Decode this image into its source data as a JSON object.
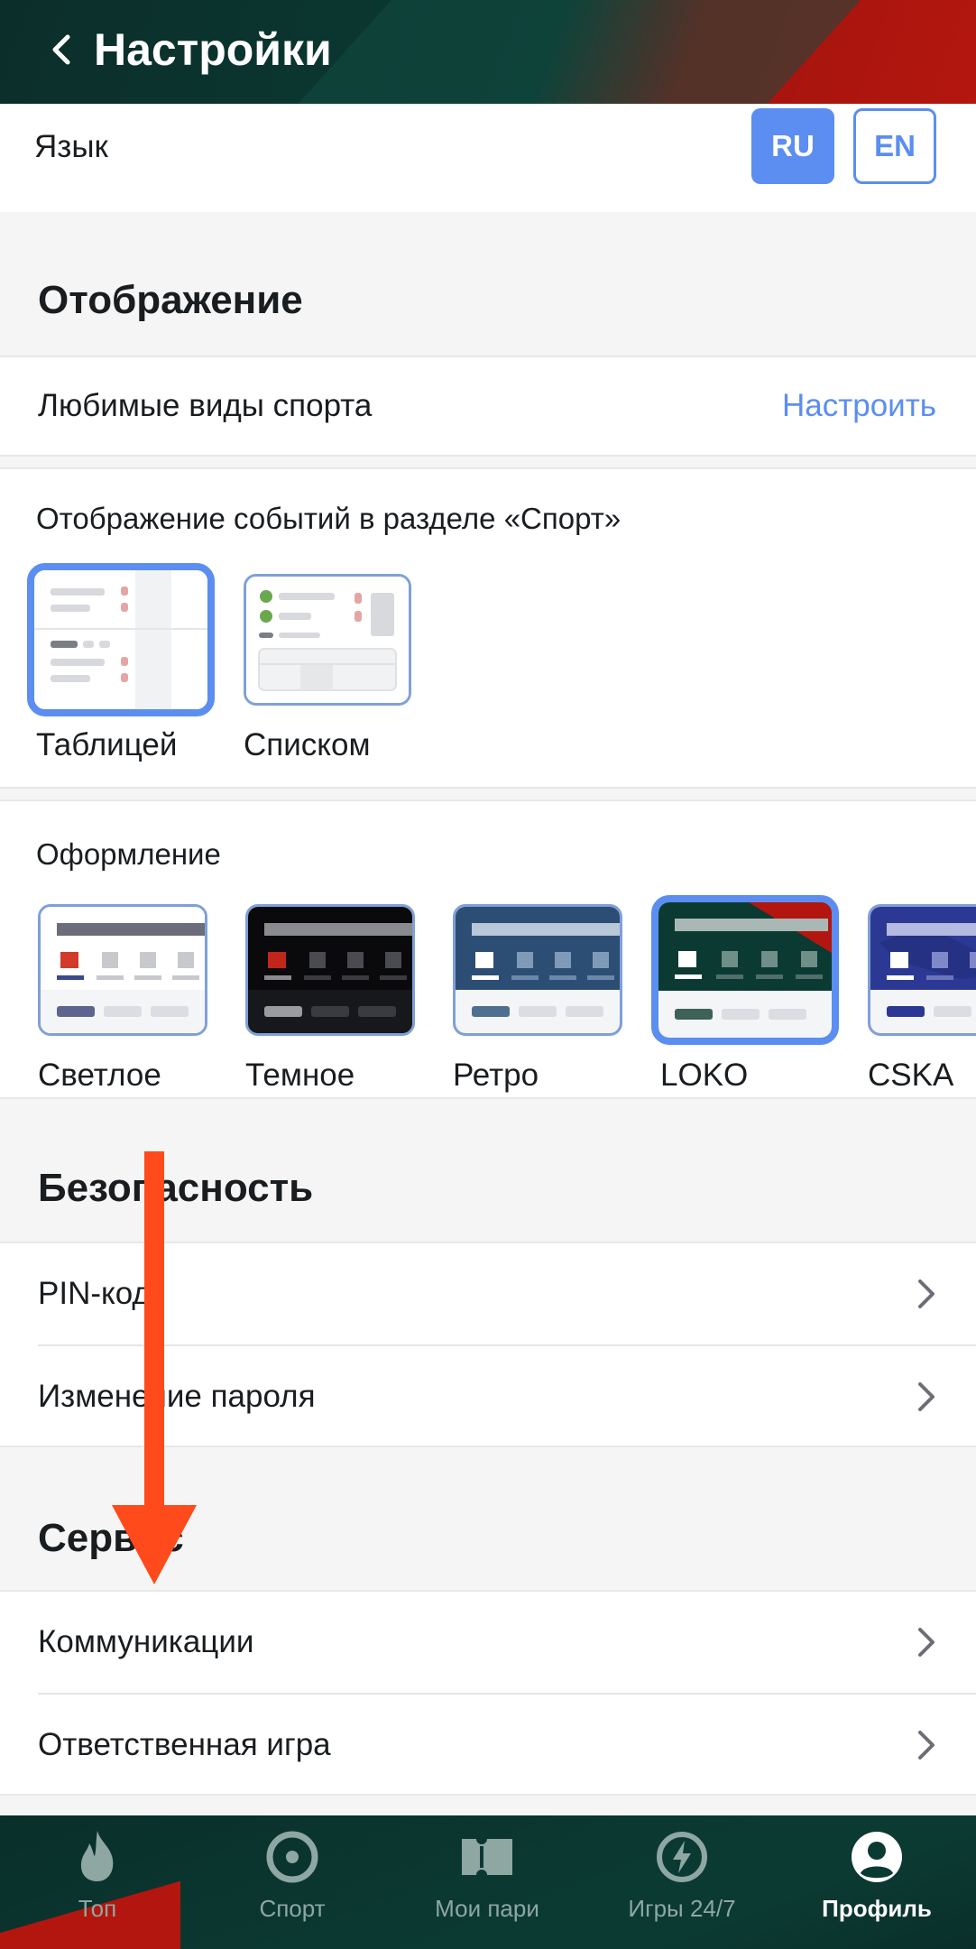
{
  "header": {
    "title": "Настройки"
  },
  "language": {
    "label": "Язык",
    "options": [
      "RU",
      "EN"
    ],
    "selected": "RU"
  },
  "display": {
    "section_title": "Отображение",
    "favorite_sports": {
      "label": "Любимые виды спорта",
      "action": "Настроить"
    },
    "events_view": {
      "label": "Отображение событий в разделе «Спорт»",
      "options": [
        "Таблицей",
        "Списком"
      ],
      "selected": "Таблицей"
    },
    "themes": {
      "label": "Оформление",
      "options": [
        "Светлое",
        "Темное",
        "Ретро",
        "LOKO",
        "CSKA"
      ],
      "selected": "LOKO"
    }
  },
  "security": {
    "section_title": "Безопасность",
    "items": [
      "PIN-код",
      "Изменение пароля"
    ]
  },
  "service": {
    "section_title": "Сервис",
    "items": [
      "Коммуникации",
      "Ответственная игра"
    ]
  },
  "bottom_nav": {
    "items": [
      "Топ",
      "Спорт",
      "Мои пари",
      "Игры 24/7",
      "Профиль"
    ],
    "active": "Профиль"
  },
  "colors": {
    "accent": "#5b8ef0",
    "header_dark": "#0a3a33",
    "header_red": "#b3160f",
    "arrow": "#ff4a1c"
  }
}
